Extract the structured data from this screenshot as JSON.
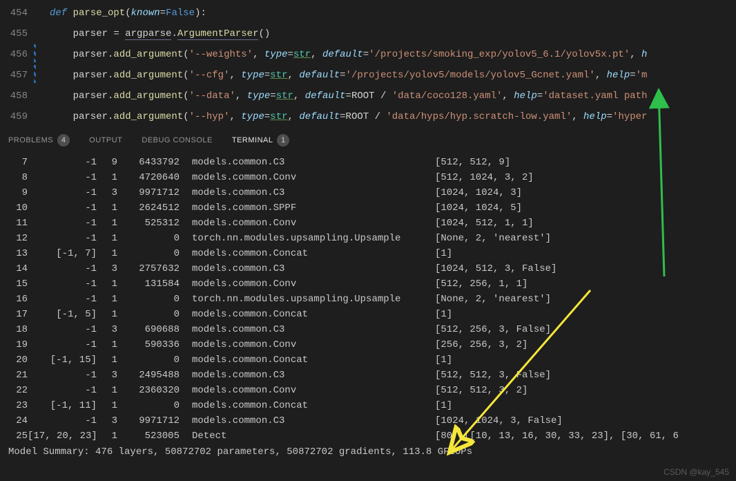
{
  "editor": {
    "lines": [
      {
        "num": "454",
        "diff": false,
        "html": "<span class='kw-def'>def</span> <span class='func'>parse_opt</span><span class='punct'>(</span><span class='kw-param'>known</span><span class='punct'>=</span><span class='kw-const'>False</span><span class='punct'>):</span>"
      },
      {
        "num": "455",
        "diff": false,
        "html": "    parser <span class='punct'>=</span> <span class='underline2'>argparse</span><span class='punct'>.</span><span class='func underline2'>ArgumentParser</span><span class='punct'>()</span>"
      },
      {
        "num": "456",
        "diff": true,
        "html": "    parser.<span class='func'>add_argument</span><span class='punct'>(</span><span class='str'>'--weights'</span><span class='punct'>, </span><span class='kw-param'>type</span><span class='punct'>=</span><span class='kw-type underline'>str</span><span class='punct'>, </span><span class='kw-param'>default</span><span class='punct'>=</span><span class='str'>'/projects/smoking_exp/yolov5_6.1/yolov5x.pt'</span><span class='punct'>, </span><span class='kw-param'>h</span>"
      },
      {
        "num": "457",
        "diff": true,
        "html": "    parser.<span class='func'>add_argument</span><span class='punct'>(</span><span class='str'>'--cfg'</span><span class='punct'>, </span><span class='kw-param'>type</span><span class='punct'>=</span><span class='kw-type underline'>str</span><span class='punct'>, </span><span class='kw-param'>default</span><span class='punct'>=</span><span class='str'>'/projects/yolov5/models/yolov5_Gcnet.yaml'</span><span class='punct'>, </span><span class='kw-param'>help</span><span class='punct'>=</span><span class='str'>'m</span>"
      },
      {
        "num": "458",
        "diff": false,
        "html": "    parser.<span class='func'>add_argument</span><span class='punct'>(</span><span class='str'>'--data'</span><span class='punct'>, </span><span class='kw-param'>type</span><span class='punct'>=</span><span class='kw-type underline'>str</span><span class='punct'>, </span><span class='kw-param'>default</span><span class='punct'>=</span>ROOT <span class='punct'>/</span> <span class='str'>'data/coco128.yaml'</span><span class='punct'>, </span><span class='kw-param'>help</span><span class='punct'>=</span><span class='str'>'dataset.yaml path</span>"
      },
      {
        "num": "459",
        "diff": false,
        "html": "    parser.<span class='func'>add_argument</span><span class='punct'>(</span><span class='str'>'--hyp'</span><span class='punct'>, </span><span class='kw-param'>type</span><span class='punct'>=</span><span class='kw-type underline'>str</span><span class='punct'>, </span><span class='kw-param'>default</span><span class='punct'>=</span>ROOT <span class='punct'>/</span> <span class='str'>'data/hyps/hyp.scratch-low.yaml'</span><span class='punct'>, </span><span class='kw-param'>help</span><span class='punct'>=</span><span class='str'>'hyper</span>"
      }
    ]
  },
  "panel": {
    "problems": "PROBLEMS",
    "problems_count": "4",
    "output": "OUTPUT",
    "debug": "DEBUG CONSOLE",
    "terminal": "TERMINAL",
    "terminal_count": "1"
  },
  "terminal": {
    "rows": [
      {
        "i": "7",
        "c1": "-1",
        "c2": "9",
        "c3": "6433792",
        "mod": "models.common.C3",
        "args": "[512, 512, 9]"
      },
      {
        "i": "8",
        "c1": "-1",
        "c2": "1",
        "c3": "4720640",
        "mod": "models.common.Conv",
        "args": "[512, 1024, 3, 2]"
      },
      {
        "i": "9",
        "c1": "-1",
        "c2": "3",
        "c3": "9971712",
        "mod": "models.common.C3",
        "args": "[1024, 1024, 3]"
      },
      {
        "i": "10",
        "c1": "-1",
        "c2": "1",
        "c3": "2624512",
        "mod": "models.common.SPPF",
        "args": "[1024, 1024, 5]"
      },
      {
        "i": "11",
        "c1": "-1",
        "c2": "1",
        "c3": "525312",
        "mod": "models.common.Conv",
        "args": "[1024, 512, 1, 1]"
      },
      {
        "i": "12",
        "c1": "-1",
        "c2": "1",
        "c3": "0",
        "mod": "torch.nn.modules.upsampling.Upsample",
        "args": "[None, 2, 'nearest']"
      },
      {
        "i": "13",
        "c1": "[-1, 7]",
        "c2": "1",
        "c3": "0",
        "mod": "models.common.Concat",
        "args": "[1]"
      },
      {
        "i": "14",
        "c1": "-1",
        "c2": "3",
        "c3": "2757632",
        "mod": "models.common.C3",
        "args": "[1024, 512, 3, False]"
      },
      {
        "i": "15",
        "c1": "-1",
        "c2": "1",
        "c3": "131584",
        "mod": "models.common.Conv",
        "args": "[512, 256, 1, 1]"
      },
      {
        "i": "16",
        "c1": "-1",
        "c2": "1",
        "c3": "0",
        "mod": "torch.nn.modules.upsampling.Upsample",
        "args": "[None, 2, 'nearest']"
      },
      {
        "i": "17",
        "c1": "[-1, 5]",
        "c2": "1",
        "c3": "0",
        "mod": "models.common.Concat",
        "args": "[1]"
      },
      {
        "i": "18",
        "c1": "-1",
        "c2": "3",
        "c3": "690688",
        "mod": "models.common.C3",
        "args": "[512, 256, 3, False]"
      },
      {
        "i": "19",
        "c1": "-1",
        "c2": "1",
        "c3": "590336",
        "mod": "models.common.Conv",
        "args": "[256, 256, 3, 2]"
      },
      {
        "i": "20",
        "c1": "[-1, 15]",
        "c2": "1",
        "c3": "0",
        "mod": "models.common.Concat",
        "args": "[1]"
      },
      {
        "i": "21",
        "c1": "-1",
        "c2": "3",
        "c3": "2495488",
        "mod": "models.common.C3",
        "args": "[512, 512, 3, False]"
      },
      {
        "i": "22",
        "c1": "-1",
        "c2": "1",
        "c3": "2360320",
        "mod": "models.common.Conv",
        "args": "[512, 512, 3, 2]"
      },
      {
        "i": "23",
        "c1": "[-1, 11]",
        "c2": "1",
        "c3": "0",
        "mod": "models.common.Concat",
        "args": "[1]"
      },
      {
        "i": "24",
        "c1": "-1",
        "c2": "3",
        "c3": "9971712",
        "mod": "models.common.C3",
        "args": "[1024, 1024, 3, False]"
      },
      {
        "i": "25",
        "c1": "[17, 20, 23]",
        "c2": "1",
        "c3": "523005",
        "mod": "Detect",
        "args": "[80, [[10, 13, 16, 30, 33, 23], [30, 61, 6"
      }
    ],
    "summary": "Model Summary: 476 layers, 50872702 parameters, 50872702 gradients, 113.8 GFLOPs"
  },
  "watermark": "CSDN @kay_545"
}
